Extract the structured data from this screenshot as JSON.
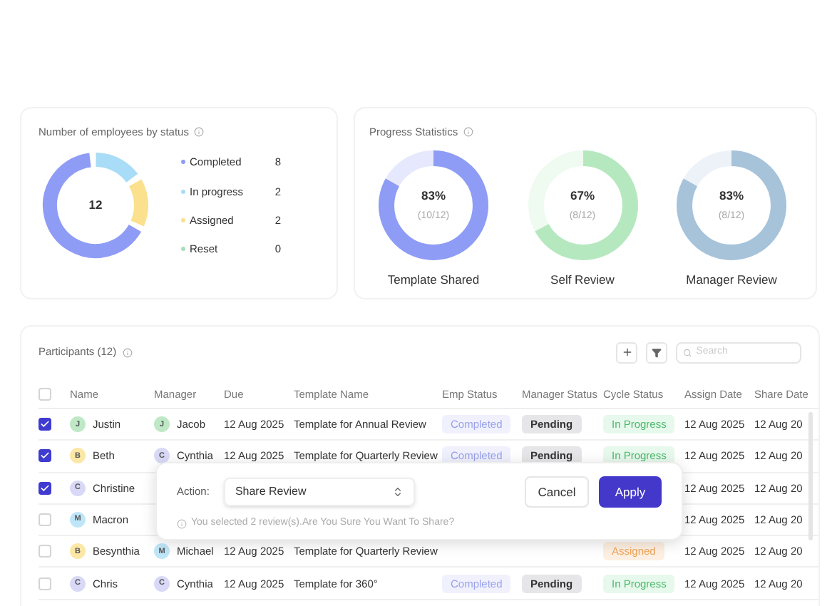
{
  "status_card": {
    "title": "Number of employees by status",
    "total": "12",
    "legend": [
      {
        "label": "Completed",
        "count": "8",
        "color": "#8f9cf5"
      },
      {
        "label": "In progress",
        "count": "2",
        "color": "#a9dcf6"
      },
      {
        "label": "Assigned",
        "count": "2",
        "color": "#fbe08e"
      },
      {
        "label": "Reset",
        "count": "0",
        "color": "#a8e0b8"
      }
    ]
  },
  "progress_card": {
    "title": "Progress Statistics",
    "rings": [
      {
        "percent": "83%",
        "fraction": "(10/12)",
        "label": "Template Shared",
        "level": 0.83,
        "color": "#8e9cf5"
      },
      {
        "percent": "67%",
        "fraction": "(8/12)",
        "label": "Self Review",
        "level": 0.67,
        "color": "#b6e8c0"
      },
      {
        "percent": "83%",
        "fraction": "(8/12)",
        "label": "Manager Review",
        "level": 0.83,
        "color": "#a7c3da"
      }
    ]
  },
  "participants": {
    "title": "Participants (12)",
    "search": {
      "placeholder": "Search"
    },
    "select_all_checked": false,
    "columns": [
      "Name",
      "Manager",
      "Due",
      "Template Name",
      "Emp Status",
      "Manager Status",
      "Cycle Status",
      "Assign Date",
      "Share Date"
    ],
    "rows": [
      {
        "checked": true,
        "name": {
          "initial": "J",
          "text": "Justin",
          "color": "#bfe9c6"
        },
        "manager": {
          "initial": "J",
          "text": "Jacob",
          "color": "#bfe9c6"
        },
        "due": "12 Aug 2025",
        "template": "Template for Annual Review",
        "emp_status": {
          "text": "Completed",
          "kind": "completed"
        },
        "manager_status": {
          "text": "Pending",
          "kind": "pending"
        },
        "cycle_status": {
          "text": "In Progress",
          "kind": "progress"
        },
        "assign_date": "12 Aug 2025",
        "share_date": "12 Aug 20"
      },
      {
        "checked": true,
        "name": {
          "initial": "B",
          "text": "Beth",
          "color": "#fbe7a6"
        },
        "manager": {
          "initial": "C",
          "text": "Cynthia",
          "color": "#d9d9f7"
        },
        "due": "12 Aug 2025",
        "template": "Template for Quarterly Review",
        "emp_status": {
          "text": "Completed",
          "kind": "completed"
        },
        "manager_status": {
          "text": "Pending",
          "kind": "pending"
        },
        "cycle_status": {
          "text": "In Progress",
          "kind": "progress"
        },
        "assign_date": "12 Aug 2025",
        "share_date": "12 Aug 20"
      },
      {
        "checked": true,
        "name": {
          "initial": "C",
          "text": "Christine",
          "color": "#d9d9f7"
        },
        "assign_date": "12 Aug 2025",
        "share_date": "12 Aug 20"
      },
      {
        "checked": false,
        "name": {
          "initial": "M",
          "text": "Macron",
          "color": "#bfe6f8"
        },
        "assign_date": "12 Aug 2025",
        "share_date": "12 Aug 20"
      },
      {
        "checked": false,
        "name": {
          "initial": "B",
          "text": "Besynthia",
          "color": "#fbe7a6"
        },
        "manager": {
          "initial": "M",
          "text": "Michael",
          "color": "#bfe6f8"
        },
        "due": "12 Aug 2025",
        "template": "Template for Quarterly Review",
        "cycle_status": {
          "text": "Assigned",
          "kind": "assigned"
        },
        "assign_date": "12 Aug 2025",
        "share_date": "12 Aug 20"
      },
      {
        "checked": false,
        "name": {
          "initial": "C",
          "text": "Chris",
          "color": "#d9d9f7"
        },
        "manager": {
          "initial": "C",
          "text": "Cynthia",
          "color": "#d9d9f7"
        },
        "due": "12 Aug 2025",
        "template": "Template for 360°",
        "emp_status": {
          "text": "Completed",
          "kind": "completed"
        },
        "manager_status": {
          "text": "Pending",
          "kind": "pending"
        },
        "cycle_status": {
          "text": "In Progress",
          "kind": "progress"
        },
        "assign_date": "12 Aug 2025",
        "share_date": "12 Aug 20"
      }
    ]
  },
  "action_popup": {
    "label": "Action:",
    "value": "Share Review",
    "cancel": "Cancel",
    "apply": "Apply",
    "note": "You selected 2 review(s).Are You Sure You Want To Share?"
  }
}
